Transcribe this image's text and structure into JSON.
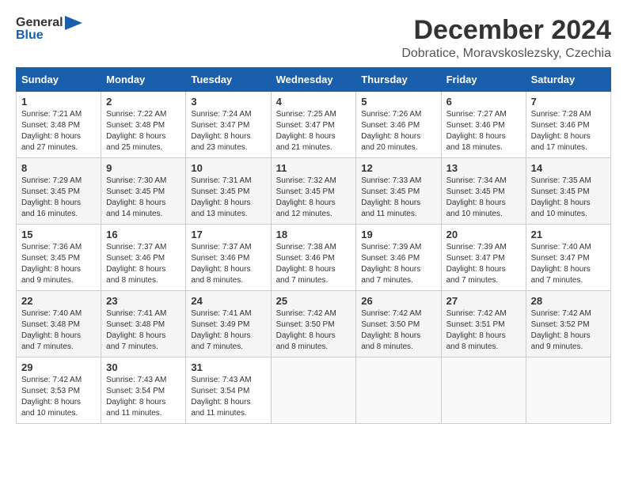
{
  "logo": {
    "line1": "General",
    "line2": "Blue"
  },
  "title": "December 2024",
  "subtitle": "Dobratice, Moravskoslezsky, Czechia",
  "weekdays": [
    "Sunday",
    "Monday",
    "Tuesday",
    "Wednesday",
    "Thursday",
    "Friday",
    "Saturday"
  ],
  "weeks": [
    [
      {
        "day": "1",
        "details": "Sunrise: 7:21 AM\nSunset: 3:48 PM\nDaylight: 8 hours\nand 27 minutes."
      },
      {
        "day": "2",
        "details": "Sunrise: 7:22 AM\nSunset: 3:48 PM\nDaylight: 8 hours\nand 25 minutes."
      },
      {
        "day": "3",
        "details": "Sunrise: 7:24 AM\nSunset: 3:47 PM\nDaylight: 8 hours\nand 23 minutes."
      },
      {
        "day": "4",
        "details": "Sunrise: 7:25 AM\nSunset: 3:47 PM\nDaylight: 8 hours\nand 21 minutes."
      },
      {
        "day": "5",
        "details": "Sunrise: 7:26 AM\nSunset: 3:46 PM\nDaylight: 8 hours\nand 20 minutes."
      },
      {
        "day": "6",
        "details": "Sunrise: 7:27 AM\nSunset: 3:46 PM\nDaylight: 8 hours\nand 18 minutes."
      },
      {
        "day": "7",
        "details": "Sunrise: 7:28 AM\nSunset: 3:46 PM\nDaylight: 8 hours\nand 17 minutes."
      }
    ],
    [
      {
        "day": "8",
        "details": "Sunrise: 7:29 AM\nSunset: 3:45 PM\nDaylight: 8 hours\nand 16 minutes."
      },
      {
        "day": "9",
        "details": "Sunrise: 7:30 AM\nSunset: 3:45 PM\nDaylight: 8 hours\nand 14 minutes."
      },
      {
        "day": "10",
        "details": "Sunrise: 7:31 AM\nSunset: 3:45 PM\nDaylight: 8 hours\nand 13 minutes."
      },
      {
        "day": "11",
        "details": "Sunrise: 7:32 AM\nSunset: 3:45 PM\nDaylight: 8 hours\nand 12 minutes."
      },
      {
        "day": "12",
        "details": "Sunrise: 7:33 AM\nSunset: 3:45 PM\nDaylight: 8 hours\nand 11 minutes."
      },
      {
        "day": "13",
        "details": "Sunrise: 7:34 AM\nSunset: 3:45 PM\nDaylight: 8 hours\nand 10 minutes."
      },
      {
        "day": "14",
        "details": "Sunrise: 7:35 AM\nSunset: 3:45 PM\nDaylight: 8 hours\nand 10 minutes."
      }
    ],
    [
      {
        "day": "15",
        "details": "Sunrise: 7:36 AM\nSunset: 3:45 PM\nDaylight: 8 hours\nand 9 minutes."
      },
      {
        "day": "16",
        "details": "Sunrise: 7:37 AM\nSunset: 3:46 PM\nDaylight: 8 hours\nand 8 minutes."
      },
      {
        "day": "17",
        "details": "Sunrise: 7:37 AM\nSunset: 3:46 PM\nDaylight: 8 hours\nand 8 minutes."
      },
      {
        "day": "18",
        "details": "Sunrise: 7:38 AM\nSunset: 3:46 PM\nDaylight: 8 hours\nand 7 minutes."
      },
      {
        "day": "19",
        "details": "Sunrise: 7:39 AM\nSunset: 3:46 PM\nDaylight: 8 hours\nand 7 minutes."
      },
      {
        "day": "20",
        "details": "Sunrise: 7:39 AM\nSunset: 3:47 PM\nDaylight: 8 hours\nand 7 minutes."
      },
      {
        "day": "21",
        "details": "Sunrise: 7:40 AM\nSunset: 3:47 PM\nDaylight: 8 hours\nand 7 minutes."
      }
    ],
    [
      {
        "day": "22",
        "details": "Sunrise: 7:40 AM\nSunset: 3:48 PM\nDaylight: 8 hours\nand 7 minutes."
      },
      {
        "day": "23",
        "details": "Sunrise: 7:41 AM\nSunset: 3:48 PM\nDaylight: 8 hours\nand 7 minutes."
      },
      {
        "day": "24",
        "details": "Sunrise: 7:41 AM\nSunset: 3:49 PM\nDaylight: 8 hours\nand 7 minutes."
      },
      {
        "day": "25",
        "details": "Sunrise: 7:42 AM\nSunset: 3:50 PM\nDaylight: 8 hours\nand 8 minutes."
      },
      {
        "day": "26",
        "details": "Sunrise: 7:42 AM\nSunset: 3:50 PM\nDaylight: 8 hours\nand 8 minutes."
      },
      {
        "day": "27",
        "details": "Sunrise: 7:42 AM\nSunset: 3:51 PM\nDaylight: 8 hours\nand 8 minutes."
      },
      {
        "day": "28",
        "details": "Sunrise: 7:42 AM\nSunset: 3:52 PM\nDaylight: 8 hours\nand 9 minutes."
      }
    ],
    [
      {
        "day": "29",
        "details": "Sunrise: 7:42 AM\nSunset: 3:53 PM\nDaylight: 8 hours\nand 10 minutes."
      },
      {
        "day": "30",
        "details": "Sunrise: 7:43 AM\nSunset: 3:54 PM\nDaylight: 8 hours\nand 11 minutes."
      },
      {
        "day": "31",
        "details": "Sunrise: 7:43 AM\nSunset: 3:54 PM\nDaylight: 8 hours\nand 11 minutes."
      },
      null,
      null,
      null,
      null
    ]
  ]
}
